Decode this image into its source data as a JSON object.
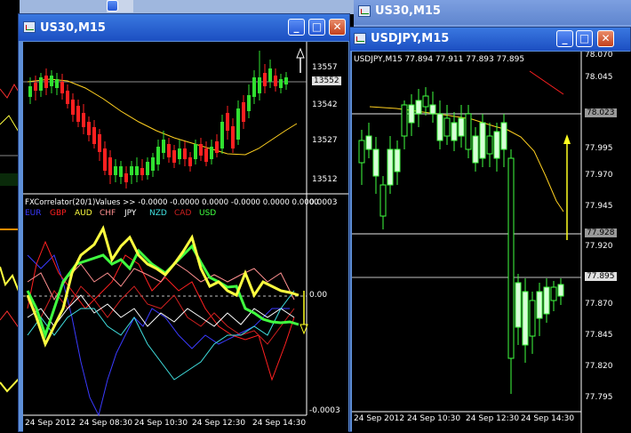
{
  "windows": {
    "us30_background": {
      "title": "US30,M15"
    },
    "usdjpy": {
      "title": "USDJPY,M15",
      "header": "USDJPY,M15  77.894 77.911 77.893 77.895",
      "price_ticks": [
        "78.070",
        "78.045",
        "78.023",
        "77.995",
        "77.970",
        "77.945",
        "77.928",
        "77.920",
        "77.895",
        "77.870",
        "77.845",
        "77.820",
        "77.795"
      ],
      "time_ticks": [
        "24 Sep 2012",
        "24 Sep 10:30",
        "24 Sep 12:30",
        "24 Sep 14:30"
      ]
    },
    "us30": {
      "title": "US30,M15",
      "price_ticks": [
        "13557",
        "13552",
        "13542",
        "13527",
        "13512"
      ],
      "indicator_header": "FXCorrelator(20/1)Values >> -0.0000 -0.0000 0.0000 -0.0000 0.0000 0.0000",
      "indicator_ticks": [
        "0.0003",
        "0.00",
        "-0.0003"
      ],
      "legend": [
        {
          "label": "EUR",
          "color": "#3a3aff"
        },
        {
          "label": "GBP",
          "color": "#ff2020"
        },
        {
          "label": "AUD",
          "color": "#ffff40"
        },
        {
          "label": "CHF",
          "color": "#ff9090"
        },
        {
          "label": "JPY",
          "color": "#ffffff"
        },
        {
          "label": "NZD",
          "color": "#40e0e0"
        },
        {
          "label": "CAD",
          "color": "#d02020"
        },
        {
          "label": "USD",
          "color": "#40ff40"
        }
      ],
      "time_ticks": [
        "24 Sep 2012",
        "24 Sep 08:30",
        "24 Sep 10:30",
        "24 Sep 12:30",
        "24 Sep 14:30"
      ]
    }
  },
  "buttons": {
    "minimize": "_",
    "maximize": "□",
    "close": "✕"
  }
}
